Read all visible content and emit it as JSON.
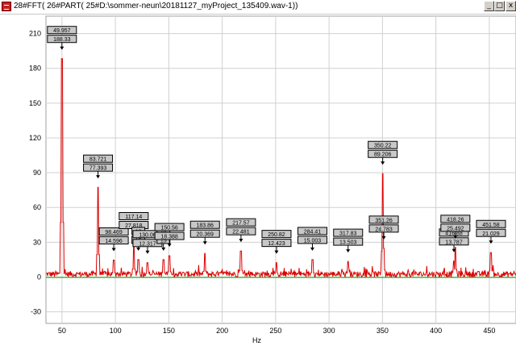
{
  "window": {
    "title": "28#FFT( 26#PART( 25#D:\\sommer-neun\\20181127_myProject_135409.wav-1))",
    "min_glyph": "_",
    "max_glyph": "□",
    "close_glyph": "x"
  },
  "chart_data": {
    "type": "line",
    "title": "",
    "xlabel": "Hz",
    "ylabel": "",
    "xlim": [
      35,
      475
    ],
    "ylim": [
      -40,
      225
    ],
    "x_ticks": [
      50,
      100,
      150,
      200,
      250,
      300,
      350,
      400,
      450
    ],
    "y_ticks": [
      -30,
      0,
      30,
      60,
      90,
      120,
      150,
      180,
      210
    ],
    "grid": true,
    "series": [
      {
        "color": "#dd0000",
        "noise_level": 5,
        "peaks": [
          {
            "x": 49.957,
            "y": 188.33
          },
          {
            "x": 83.721,
            "y": 77.393
          },
          {
            "x": 98.469,
            "y": 14.596
          },
          {
            "x": 117.14,
            "y": 27.818
          },
          {
            "x": 121.5,
            "y": 15
          },
          {
            "x": 130.06,
            "y": 12.317
          },
          {
            "x": 145,
            "y": 15
          },
          {
            "x": 150.56,
            "y": 18.388
          },
          {
            "x": 183.86,
            "y": 20.369
          },
          {
            "x": 217.57,
            "y": 22.481
          },
          {
            "x": 250.82,
            "y": 12.423
          },
          {
            "x": 284.41,
            "y": 15.003
          },
          {
            "x": 317.83,
            "y": 13.503
          },
          {
            "x": 350.22,
            "y": 89.206
          },
          {
            "x": 351.26,
            "y": 24.783
          },
          {
            "x": 416.9,
            "y": 13.7
          },
          {
            "x": 418.26,
            "y": 25.492
          },
          {
            "x": 451.58,
            "y": 21.029
          }
        ]
      },
      {
        "color": "#00a000",
        "constant": 0
      }
    ],
    "annotations": [
      {
        "x": 49.957,
        "y": 188.33,
        "freq": "49.957",
        "amp": "188.33"
      },
      {
        "x": 83.721,
        "y": 77.393,
        "freq": "83.721",
        "amp": "77.393"
      },
      {
        "x": 98.469,
        "y": 14.596,
        "freq": "98.469",
        "amp": "14.596"
      },
      {
        "x": 117.14,
        "y": 27.818,
        "freq": "117.14",
        "amp": "27.818"
      },
      {
        "x": 121.5,
        "y": 15,
        "freq": "12",
        "amp": "15"
      },
      {
        "x": 130.06,
        "y": 12.317,
        "freq": "130.06",
        "amp": "12.317"
      },
      {
        "x": 145,
        "y": 15,
        "freq": "14",
        "amp": "15"
      },
      {
        "x": 150.56,
        "y": 18.388,
        "freq": "150.56",
        "amp": "18.388"
      },
      {
        "x": 183.86,
        "y": 20.369,
        "freq": "183.86",
        "amp": "20.369"
      },
      {
        "x": 217.57,
        "y": 22.481,
        "freq": "217.57",
        "amp": "22.481"
      },
      {
        "x": 250.82,
        "y": 12.423,
        "freq": "250.82",
        "amp": "12.423"
      },
      {
        "x": 284.41,
        "y": 15.003,
        "freq": "284.41",
        "amp": "15.003"
      },
      {
        "x": 317.83,
        "y": 13.503,
        "freq": "317.83",
        "amp": "13.503"
      },
      {
        "x": 350.22,
        "y": 89.206,
        "freq": "350.22",
        "amp": "89.206"
      },
      {
        "x": 351.26,
        "y": 24.783,
        "freq": "351.26",
        "amp": "24.783"
      },
      {
        "x": 416.9,
        "y": 13.7,
        "freq": "416.88",
        "amp": "13.787"
      },
      {
        "x": 418.26,
        "y": 25.492,
        "freq": "418.26",
        "amp": "25.492"
      },
      {
        "x": 451.58,
        "y": 21.029,
        "freq": "451.58",
        "amp": "21.029"
      }
    ]
  }
}
